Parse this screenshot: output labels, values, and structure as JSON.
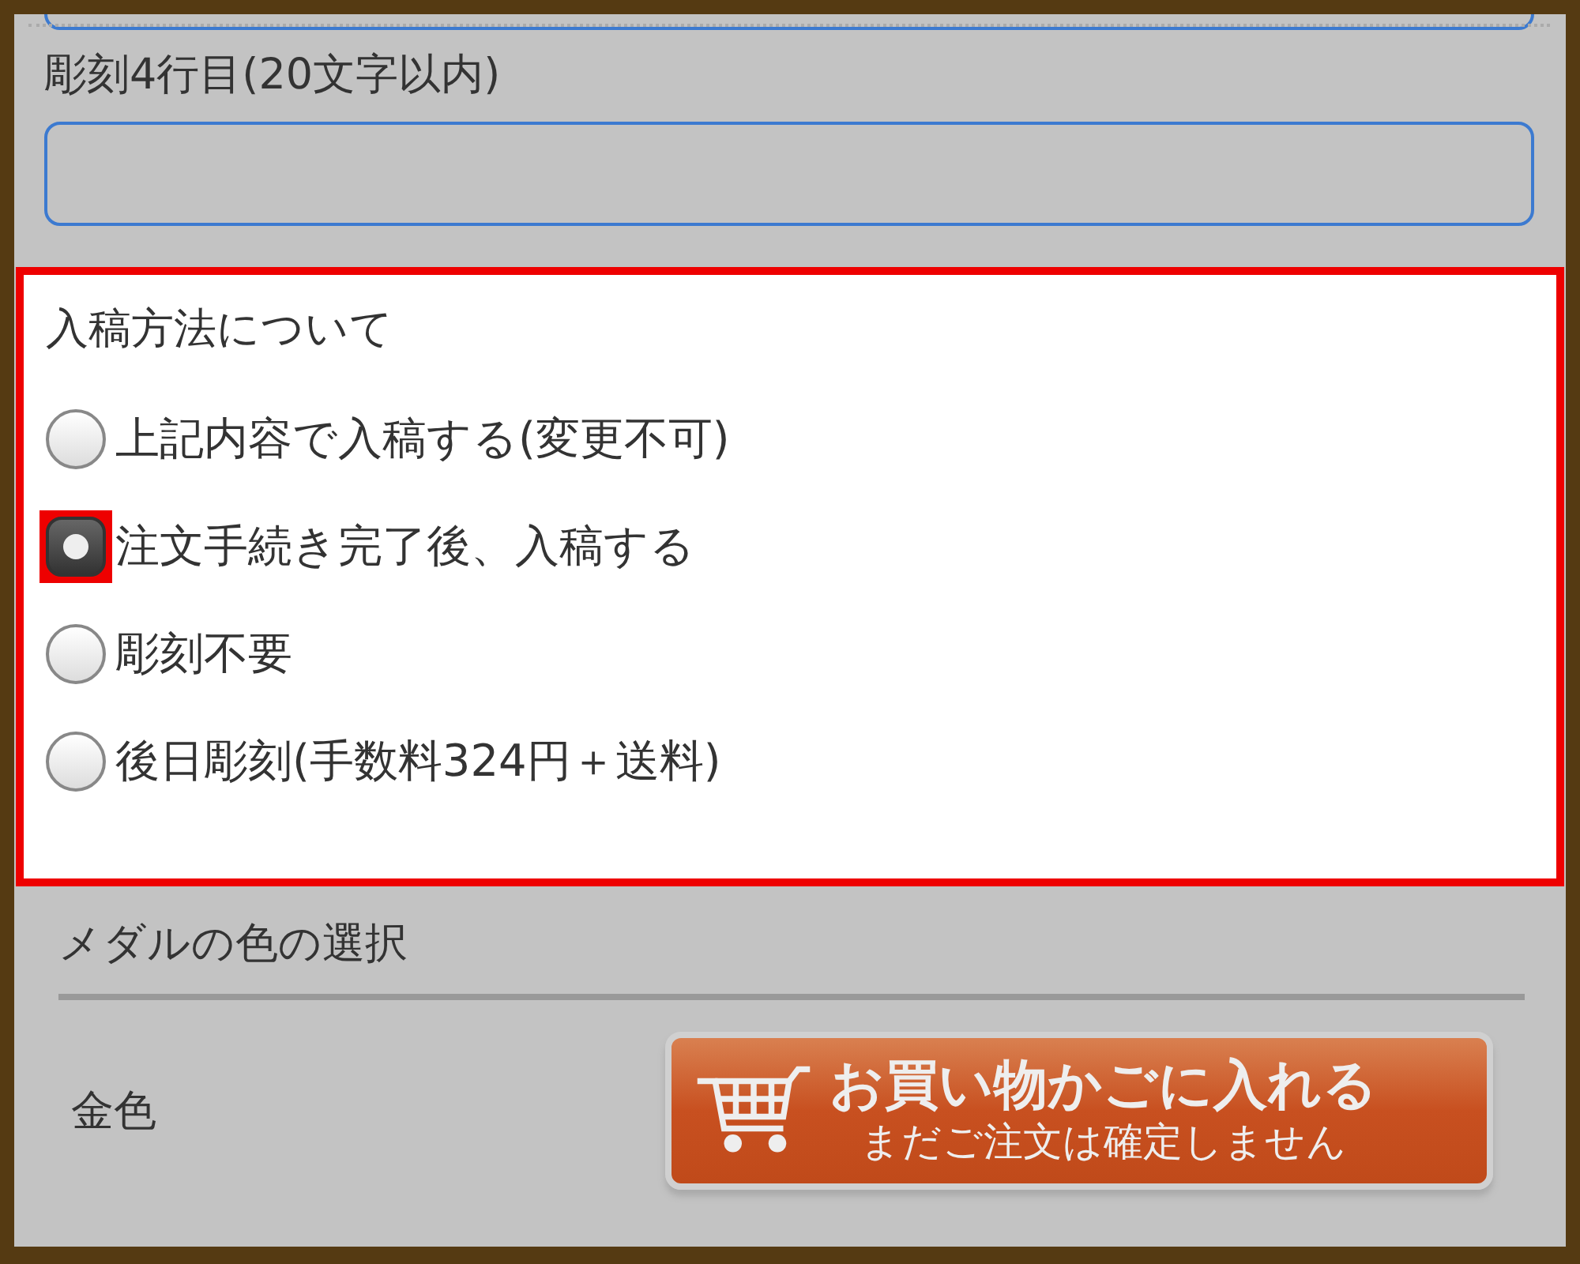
{
  "engraving_fields": [
    {
      "kind": "clipped"
    },
    {
      "kind": "labeled",
      "label": "彫刻4行目(20文字以内)"
    }
  ],
  "submission": {
    "title": "入稿方法について",
    "highlighted": true,
    "options": [
      {
        "label": "上記内容で入稿する(変更不可)",
        "selected": false,
        "annotated": false
      },
      {
        "label": "注文手続き完了後、入稿する",
        "selected": true,
        "annotated": true
      },
      {
        "label": "彫刻不要",
        "selected": false,
        "annotated": false
      },
      {
        "label": "後日彫刻(手数料324円＋送料)",
        "selected": false,
        "annotated": false
      }
    ]
  },
  "medal_color": {
    "title": "メダルの色の選択",
    "color_name": "金色",
    "cart_button": {
      "line1": "お買い物かごに入れる",
      "line2": "まだご注文は確定しません"
    }
  }
}
